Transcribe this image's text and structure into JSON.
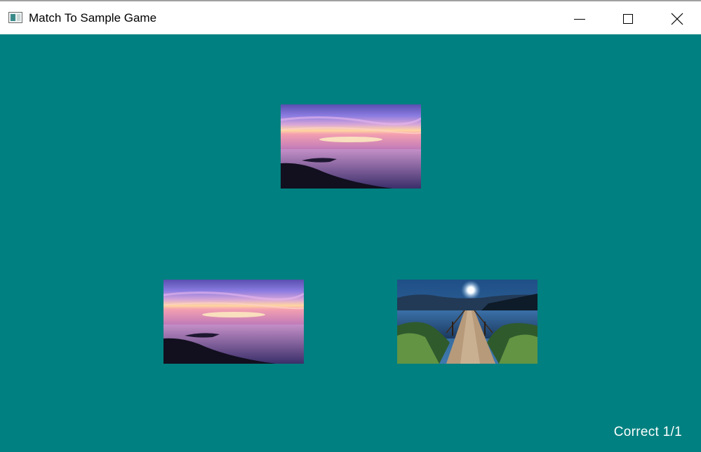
{
  "window": {
    "title": "Match To Sample Game",
    "icon": "app-window-icon",
    "controls": {
      "minimize_icon": "minimize-icon",
      "maximize_icon": "maximize-icon",
      "close_icon": "close-icon"
    }
  },
  "game": {
    "background_color": "#008080",
    "sample_image": "sunset-over-sea",
    "choices": [
      {
        "image": "sunset-over-sea"
      },
      {
        "image": "moonlit-lake-pier"
      }
    ],
    "status_text": "Correct 1/1"
  }
}
